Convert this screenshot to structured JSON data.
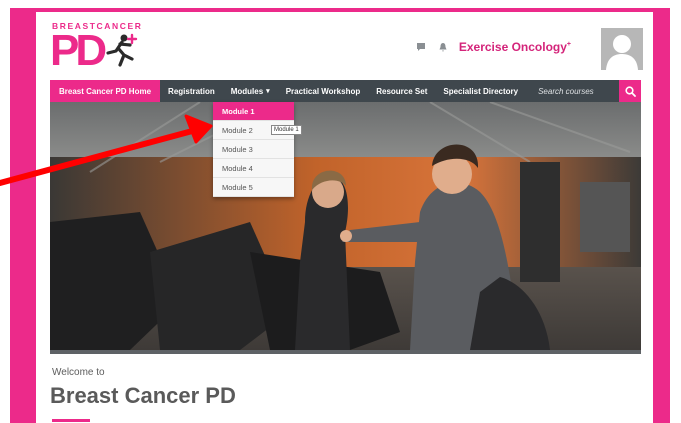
{
  "logo": {
    "top_text": "BREASTCANCER",
    "main_text": "PD"
  },
  "header": {
    "user_name": "Exercise Oncology",
    "user_suffix": "+"
  },
  "nav": {
    "items": [
      {
        "label": "Breast Cancer PD Home",
        "active": true
      },
      {
        "label": "Registration"
      },
      {
        "label": "Modules",
        "caret": "▾"
      },
      {
        "label": "Practical Workshop"
      },
      {
        "label": "Resource Set"
      },
      {
        "label": "Specialist Directory"
      }
    ],
    "search_placeholder": "Search courses"
  },
  "dropdown": {
    "items": [
      "Module 1",
      "Module 2",
      "Module 3",
      "Module 4",
      "Module 5"
    ],
    "active_index": 0,
    "tooltip": "Module 1"
  },
  "main": {
    "welcome": "Welcome to",
    "title": "Breast Cancer PD"
  },
  "colors": {
    "brand": "#ec2a8a",
    "nav": "#3f474d",
    "annotation_arrow": "#ff0000"
  },
  "icons": [
    "runner-icon",
    "chat-icon",
    "bell-icon",
    "search-icon",
    "avatar-icon"
  ]
}
